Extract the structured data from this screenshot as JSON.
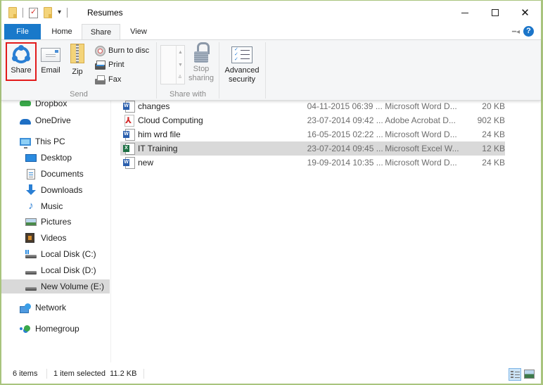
{
  "window": {
    "title": "Resumes",
    "controls": {
      "minimize": "minimize",
      "maximize": "maximize",
      "close": "close"
    }
  },
  "quick_access": {
    "icons": [
      "folder-icon",
      "properties-icon",
      "new-folder-icon",
      "customize-dropdown-icon"
    ],
    "dropdown_glyph": "▾"
  },
  "tabs": [
    {
      "label": "File",
      "active": false
    },
    {
      "label": "Home",
      "active": false
    },
    {
      "label": "Share",
      "active": true
    },
    {
      "label": "View",
      "active": false
    }
  ],
  "ribbon_right": {
    "pin_glyph": "⊣",
    "help_glyph": "?"
  },
  "ribbon": {
    "groups": {
      "send": {
        "label": "Send",
        "share": "Share",
        "email": "Email",
        "zip": "Zip",
        "burn": "Burn to disc",
        "print": "Print",
        "fax": "Fax"
      },
      "share_with": {
        "label": "Share with",
        "stop_sharing_line1": "Stop",
        "stop_sharing_line2": "sharing"
      },
      "security": {
        "advanced_line1": "Advanced",
        "advanced_line2": "security"
      }
    },
    "highlight_color": "#e21b1b"
  },
  "nav": {
    "items": [
      {
        "label": "Dropbox",
        "icon": "dropbox-icon"
      },
      {
        "label": "OneDrive",
        "icon": "onedrive-icon"
      },
      {
        "label": "This PC",
        "icon": "this-pc-icon"
      },
      {
        "label": "Desktop",
        "icon": "desktop-icon"
      },
      {
        "label": "Documents",
        "icon": "documents-icon"
      },
      {
        "label": "Downloads",
        "icon": "downloads-icon"
      },
      {
        "label": "Music",
        "icon": "music-icon"
      },
      {
        "label": "Pictures",
        "icon": "pictures-icon"
      },
      {
        "label": "Videos",
        "icon": "videos-icon"
      },
      {
        "label": "Local Disk (C:)",
        "icon": "local-disk-c-icon"
      },
      {
        "label": "Local Disk (D:)",
        "icon": "local-disk-d-icon"
      },
      {
        "label": "New Volume (E:)",
        "icon": "new-volume-e-icon",
        "selected": true
      },
      {
        "label": "Network",
        "icon": "network-icon"
      },
      {
        "label": "Homegroup",
        "icon": "homegroup-icon"
      }
    ]
  },
  "files": [
    {
      "name": "changes",
      "date": "04-11-2015 06:39 ...",
      "type": "Microsoft Word D...",
      "size": "20 KB",
      "icon": "word-document-icon"
    },
    {
      "name": "Cloud Computing",
      "date": "23-07-2014 09:42 ...",
      "type": "Adobe Acrobat D...",
      "size": "902 KB",
      "icon": "pdf-document-icon"
    },
    {
      "name": "him wrd file",
      "date": "16-05-2015 02:22 ...",
      "type": "Microsoft Word D...",
      "size": "24 KB",
      "icon": "word-document-icon"
    },
    {
      "name": "IT Training",
      "date": "23-07-2014 09:45 ...",
      "type": "Microsoft Excel W...",
      "size": "12 KB",
      "icon": "excel-workbook-icon",
      "selected": true
    },
    {
      "name": "new",
      "date": "19-09-2014 10:35 ...",
      "type": "Microsoft Word D...",
      "size": "24 KB",
      "icon": "word-document-icon"
    }
  ],
  "status": {
    "item_count": "6 items",
    "selection": "1 item selected  11.2 KB"
  },
  "colors": {
    "file_tab": "#1979ca",
    "window_border": "#a9c47e",
    "selection": "#d9d9d9"
  }
}
